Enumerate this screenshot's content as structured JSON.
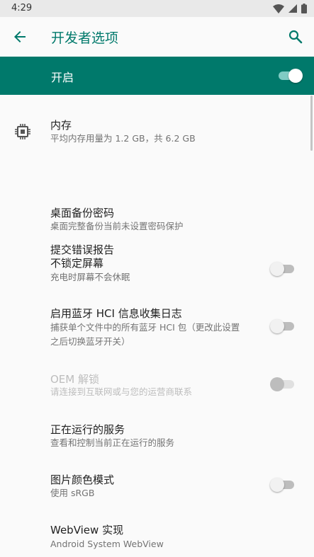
{
  "status_bar": {
    "time": "4:29"
  },
  "app_bar": {
    "title": "开发者选项"
  },
  "master": {
    "label": "开启",
    "enabled": true
  },
  "items": [
    {
      "title": "内存",
      "summary": "平均内存用量为 1.2 GB，共 6.2 GB",
      "icon": "memory-chip-icon"
    },
    {
      "title": "提交错误报告"
    },
    {
      "title": "桌面备份密码",
      "summary": "桌面完整备份当前未设置密码保护"
    },
    {
      "title": "不锁定屏幕",
      "summary": "充电时屏幕不会休眠",
      "switch": false
    },
    {
      "title": "启用蓝牙 HCI 信息收集日志",
      "summary_lines": [
        "捕获单个文件中的所有蓝牙 HCI 包（更改此设置",
        "之后切换蓝牙开关）"
      ],
      "switch": false
    },
    {
      "title": "OEM 解锁",
      "summary": "请连接到互联网或与您的运营商联系",
      "switch": false,
      "disabled": true
    },
    {
      "title": "正在运行的服务",
      "summary": "查看和控制当前正在运行的服务"
    },
    {
      "title": "图片颜色模式",
      "summary": "使用 sRGB",
      "switch": false
    },
    {
      "title": "WebView 实现",
      "summary": "Android System WebView"
    }
  ]
}
